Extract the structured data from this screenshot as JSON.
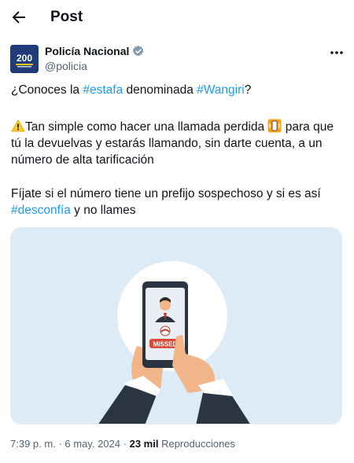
{
  "header": {
    "title": "Post"
  },
  "author": {
    "name": "Policía Nacional",
    "handle": "@policia",
    "avatar_text": "200"
  },
  "tweet": {
    "p1_prefix": "¿Conoces la ",
    "p1_tag1": "#estafa",
    "p1_mid": " denominada ",
    "p1_tag2": "#Wangiri",
    "p1_suffix": "?",
    "p2_text_a": "Tan simple como hacer una llamada perdida ",
    "p2_text_b": " para que tú la devuelvas y estarás llamando, sin darte cuenta, a un número de alta tarificación",
    "p3_text_a": "Fíjate si el número tiene un prefijo sospechoso y si es así ",
    "p3_tag": "#desconfía",
    "p3_text_b": " y no llames"
  },
  "media": {
    "missed_label": "MISSED"
  },
  "meta": {
    "time": "7:39 p. m.",
    "sep1": "·",
    "date": "6 may. 2024",
    "sep2": "·",
    "views_count": "23 mil",
    "views_label": "Reproducciones"
  },
  "colors": {
    "link": "#1d9bf0",
    "verified": "#829aab",
    "secondary": "#536471"
  },
  "icons": [
    "back-arrow-icon",
    "verified-badge-icon",
    "more-options-icon",
    "warning-emoji-icon",
    "vibration-mode-emoji-icon",
    "missed-call-icon"
  ]
}
